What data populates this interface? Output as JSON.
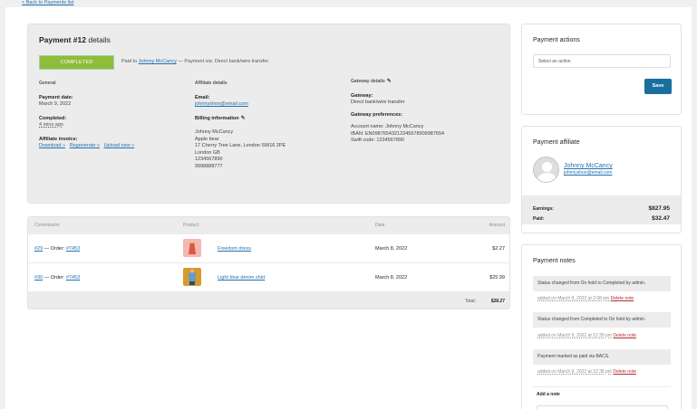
{
  "back_link": "< Back to Payments list",
  "details": {
    "title_bold": "Payment #12",
    "title_rest": " details",
    "status": "COMPLETED",
    "paid_to_prefix": "Paid to ",
    "paid_to_name": "Johnny McCancy",
    "paid_via": " — Payment via: Direct bank/wire transfer",
    "general": {
      "heading": "General",
      "payment_date_label": "Payment date:",
      "payment_date": "March 9, 2022",
      "completed_label": "Completed:",
      "completed": "4 mins ago",
      "invoice_label": "Affiliate invoice:",
      "download": "Download »",
      "regenerate": "Regenerate »",
      "upload": "Upload new »"
    },
    "affiliate": {
      "heading": "Affiliate details",
      "email_label": "Email:",
      "email": "johnnyshoo@email.com",
      "billing_label": "Billing information",
      "billing_lines": [
        "Johnny McCancy",
        "Apple bear",
        "17 Cherry Tree Lane, London SW16 2PE",
        "London GB",
        "1234567890",
        "9998888777"
      ]
    },
    "gateway": {
      "heading": "Gateway details",
      "gateway_label": "Gateway:",
      "gateway": "Direct bank/wire transfer",
      "prefs_label": "Gateway preferences:",
      "account_name": "Account name: Johnny McCancy",
      "iban": "IBAN: EN09876543212345678909987654",
      "swift": "Swift code: 1234567890"
    }
  },
  "items": {
    "headers": {
      "commission": "Commission",
      "product": "Product",
      "date": "Date",
      "amount": "Amount"
    },
    "rows": [
      {
        "commission_id": "#29",
        "sep": " — Order: ",
        "order": "#7453",
        "product": "Freedom dress",
        "date": "March 8, 2022",
        "amount": "$2.27",
        "thumb_color": "#f3b8b0"
      },
      {
        "commission_id": "#30",
        "sep": " — Order: ",
        "order": "#7453",
        "product": "Light blue denim shirt",
        "date": "March 8, 2022",
        "amount": "$25.99",
        "thumb_color": "#d99a2b"
      }
    ],
    "total_label": "Total:",
    "total": "$28.27"
  },
  "actions": {
    "title": "Payment actions",
    "select_placeholder": "Select an action",
    "save": "Save"
  },
  "payment_affiliate": {
    "title": "Payment affiliate",
    "name": "Johnny McCancy",
    "email": "johnnyshoo@email.com",
    "earnings_label": "Earnings:",
    "earnings": "$827.95",
    "paid_label": "Paid:",
    "paid": "$32.47"
  },
  "notes": {
    "title": "Payment notes",
    "items": [
      {
        "text": "Status changed from On hold to Completed by admin.",
        "when": "added on March 9, 2022 at 2:08 pm",
        "delete": "Delete note"
      },
      {
        "text": "Status changed from Completed to On hold by admin.",
        "when": "added on March 9, 2022 at 12:39 pm",
        "delete": "Delete note"
      },
      {
        "text": "Payment marked as paid via BACS.",
        "when": "added on March 9, 2022 at 12:38 pm",
        "delete": "Delete note"
      }
    ],
    "add_label": "Add a note"
  },
  "colors": {
    "status": "#8fbc3a",
    "primary_button": "#1a6f9e",
    "link": "#2271b1",
    "delete": "#b32d2e"
  }
}
